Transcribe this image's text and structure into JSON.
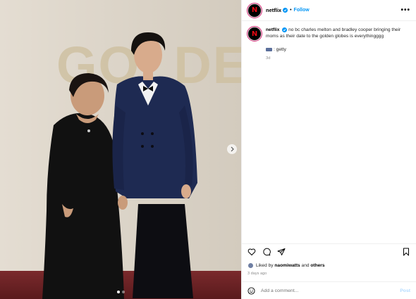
{
  "post": {
    "username": "netflix",
    "follow_label": "Follow",
    "separator": "•",
    "more_label": "•••",
    "avatar_letter": "N",
    "caption": "no bc charles melton and bradley cooper bringing their moms as their date to the golden globes is everythingggg",
    "credit": ": getty",
    "caption_age": "3d",
    "backdrop_text": "GOLDEN GLOBES",
    "likes_prefix": "Liked by",
    "likes_user": "naomiwatts",
    "likes_and": "and",
    "likes_others": "others",
    "post_date": "3 days ago",
    "comment_placeholder": "Add a comment...",
    "post_label": "Post",
    "carousel": {
      "total": 2,
      "active": 1
    }
  },
  "colors": {
    "follow": "#0095f6",
    "verified": "#0095f6",
    "brand_red": "#e50914",
    "post_disabled": "#b3dbff"
  },
  "icons": [
    "verified-icon",
    "more-icon",
    "heart-icon",
    "comment-icon",
    "share-icon",
    "save-icon",
    "emoji-icon",
    "chevron-right-icon"
  ]
}
